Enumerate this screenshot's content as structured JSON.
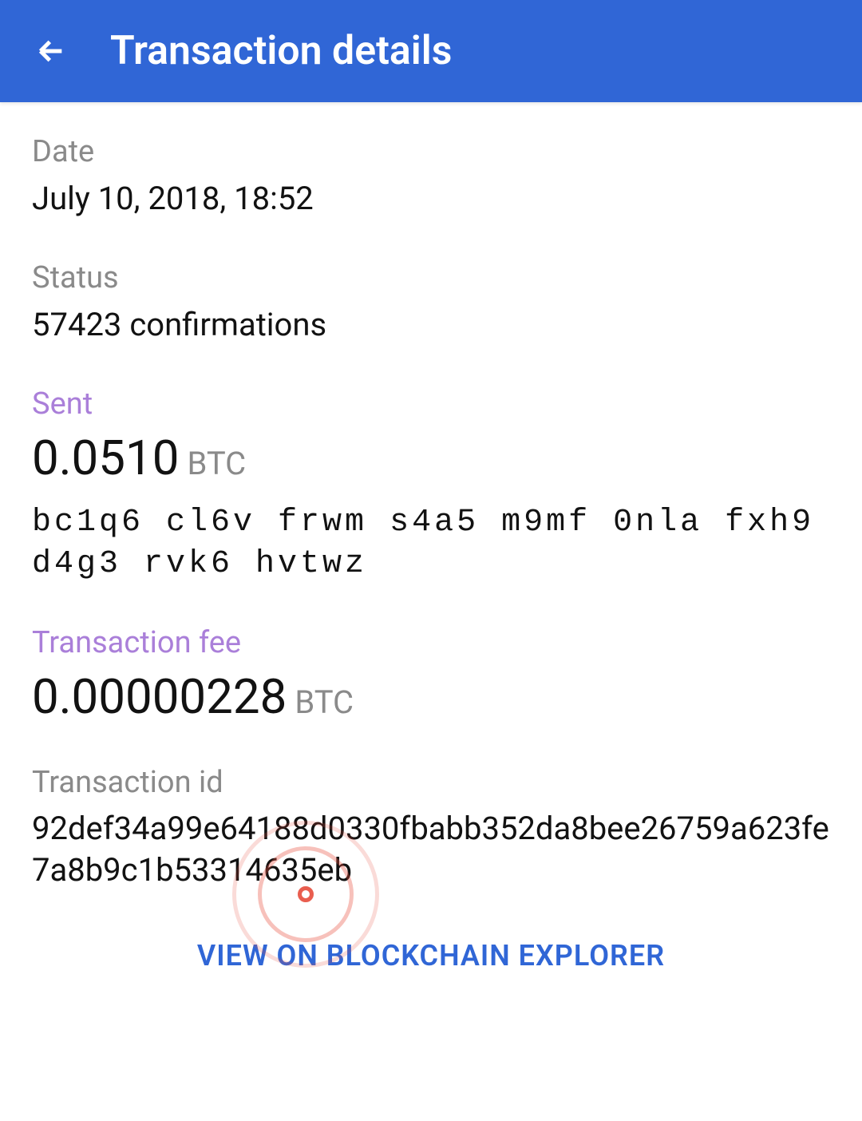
{
  "header": {
    "title": "Transaction details"
  },
  "date": {
    "label": "Date",
    "value": "July 10, 2018, 18:52"
  },
  "status": {
    "label": "Status",
    "value": "57423 confirmations"
  },
  "sent": {
    "label": "Sent",
    "amount": "0.0510",
    "currency": "BTC",
    "address": "bc1q6 cl6v frwm s4a5 m9mf 0nla fxh9 d4g3 rvk6 hvtwz"
  },
  "fee": {
    "label": "Transaction fee",
    "amount": "0.00000228",
    "currency": "BTC"
  },
  "txid": {
    "label": "Transaction id",
    "value": "92def34a99e64188d0330fbabb352da8bee26759a623fe7a8b9c1b53314635eb"
  },
  "explorer": {
    "label": "VIEW ON BLOCKCHAIN EXPLORER"
  }
}
